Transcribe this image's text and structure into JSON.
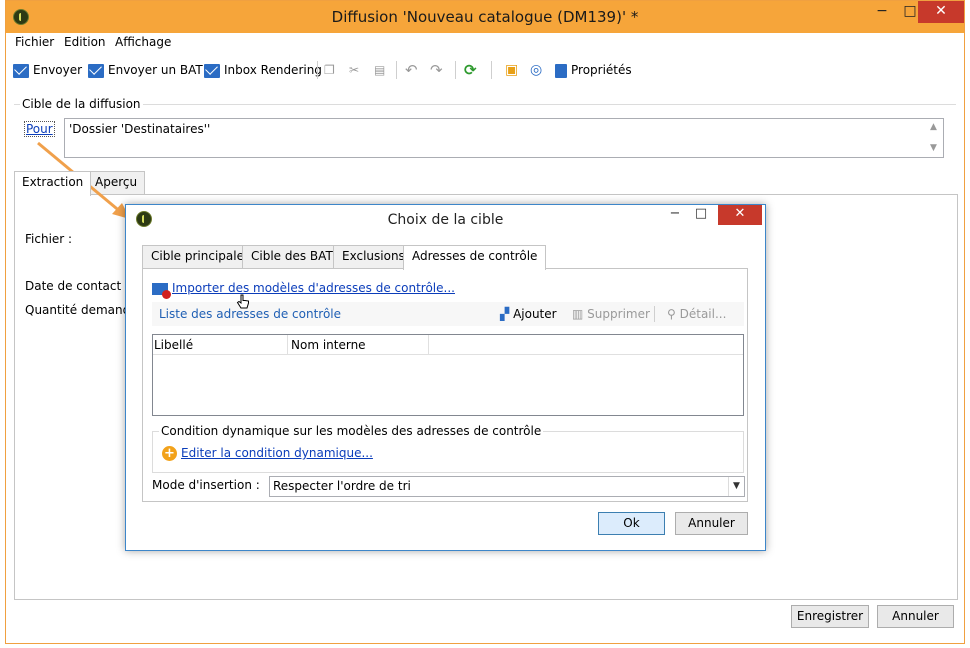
{
  "window": {
    "title": "Diffusion 'Nouveau catalogue (DM139)' *",
    "minimize": "−",
    "maximize": "□",
    "close": "✕"
  },
  "menu": [
    "Fichier",
    "Edition",
    "Affichage"
  ],
  "toolbar": {
    "send": "Envoyer",
    "send_bat": "Envoyer un BAT",
    "inbox_rendering": "Inbox Rendering",
    "properties": "Propriétés"
  },
  "target": {
    "group_title": "Cible de la diffusion",
    "link": "Pour",
    "value": "'Dossier 'Destinataires''"
  },
  "main_tabs": [
    "Extraction",
    "Aperçu"
  ],
  "fields": {
    "file": "Fichier :",
    "contact_date": "Date de contact :",
    "quantity": "Quantité demandée"
  },
  "footer": {
    "save": "Enregistrer",
    "cancel": "Annuler"
  },
  "dialog": {
    "title": "Choix de la cible",
    "tabs": [
      "Cible principale",
      "Cible des BAT",
      "Exclusions",
      "Adresses de contrôle"
    ],
    "import_link": "Importer des modèles d'adresses de contrôle...",
    "list_title": "Liste des adresses de contrôle",
    "add": "Ajouter",
    "delete": "Supprimer",
    "detail": "Détail...",
    "columns": [
      "Libellé",
      "Nom interne"
    ],
    "condition_title": "Condition dynamique sur les modèles des adresses de contrôle",
    "edit_condition": "Editer la condition dynamique...",
    "insertion_mode_label": "Mode d'insertion :",
    "insertion_mode_value": "Respecter l'ordre de tri",
    "ok": "Ok",
    "cancel": "Annuler"
  },
  "colors": {
    "titlebar": "#f6a53a",
    "close_button": "#c7392b",
    "dialog_border": "#3d86c9",
    "link": "#0b3dba",
    "arrow": "#f0a04b"
  }
}
